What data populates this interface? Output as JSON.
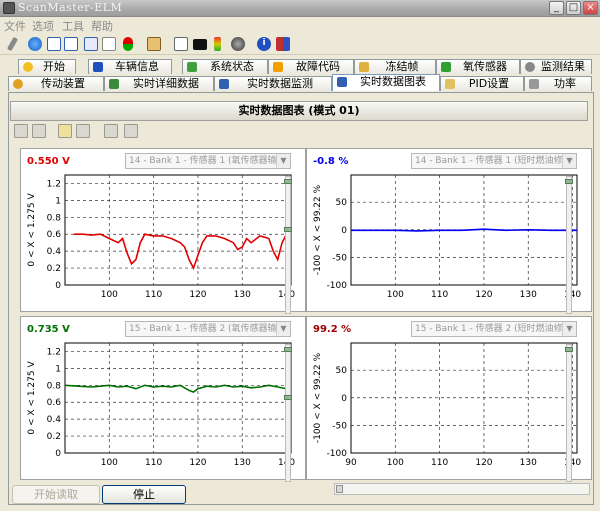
{
  "app": {
    "title": "ScanMaster-ELM"
  },
  "menu": [
    "文件",
    "选项",
    "工具",
    "帮助"
  ],
  "toolbar": [
    "wrench-icon",
    "globe-icon",
    "document-icon",
    "chart-icon",
    "meter-icon",
    "dice-icon",
    "clipboard-icon",
    "speech-icon",
    "monitor-icon",
    "battery-icon",
    "disc-icon",
    "info-icon",
    "book-icon"
  ],
  "tabs_row1": [
    "开始",
    "车辆信息",
    "系统状态",
    "故障代码",
    "冻结帧",
    "氧传感器",
    "监测结果"
  ],
  "tabs_row2": [
    "传动装置",
    "实时详细数据",
    "实时数据监测",
    "实时数据图表",
    "PID设置",
    "功率"
  ],
  "panel": {
    "title": "实时数据图表 (模式 01)"
  },
  "charts": [
    {
      "value": "0.550 V",
      "value_color": "#e00000",
      "select": "14 - Bank 1 - 传感器 1 (氧传感器输出",
      "ylabel": "0  < X <  1.275  V",
      "yticks": [
        "1.2",
        "1",
        "0.8",
        "0.6",
        "0.4",
        "0.2",
        "0"
      ],
      "xticks": [
        "100",
        "110",
        "120",
        "130",
        "140"
      ]
    },
    {
      "value": "-0.8 %",
      "value_color": "#0000ee",
      "select": "14 - Bank 1 - 传感器 1 (短时燃油修正",
      "ylabel": "-100  < X <  99.22  %",
      "yticks": [
        "50",
        "0",
        "-50",
        "-100"
      ],
      "xticks": [
        "100",
        "110",
        "120",
        "130",
        "140"
      ]
    },
    {
      "value": "0.735 V",
      "value_color": "#007000",
      "select": "15 - Bank 1 - 传感器 2 (氧传感器输出",
      "ylabel": "0  < X <  1.275  V",
      "yticks": [
        "1.2",
        "1",
        "0.8",
        "0.6",
        "0.4",
        "0.2",
        "0"
      ],
      "xticks": [
        "100",
        "110",
        "120",
        "130",
        "140"
      ]
    },
    {
      "value": "99.2 %",
      "value_color": "#a00000",
      "select": "15 - Bank 1 - 传感器 2 (短时燃油修正",
      "ylabel": "-100  < X <  99.22  %",
      "yticks": [
        "50",
        "0",
        "-50",
        "-100"
      ],
      "xticks": [
        "90",
        "100",
        "110",
        "120",
        "130",
        "140"
      ]
    }
  ],
  "chart_data": [
    {
      "type": "line",
      "x": [
        92,
        94,
        96,
        98,
        100,
        102,
        103,
        104,
        105,
        106,
        107,
        108,
        110,
        112,
        114,
        116,
        117,
        118,
        119,
        120,
        121,
        122,
        124,
        126,
        128,
        129,
        130,
        131,
        132,
        134,
        136,
        137,
        138,
        139,
        140,
        141
      ],
      "series": [
        {
          "values": [
            0.6,
            0.6,
            0.59,
            0.6,
            0.55,
            0.5,
            0.55,
            0.38,
            0.25,
            0.3,
            0.5,
            0.6,
            0.58,
            0.58,
            0.55,
            0.5,
            0.45,
            0.3,
            0.2,
            0.35,
            0.5,
            0.58,
            0.58,
            0.55,
            0.5,
            0.42,
            0.45,
            0.55,
            0.5,
            0.58,
            0.55,
            0.4,
            0.3,
            0.5,
            0.6,
            0.55
          ],
          "color": "#e00000"
        }
      ],
      "xlim": [
        90,
        141
      ],
      "ylim": [
        0,
        1.3
      ],
      "grid": true
    },
    {
      "type": "line",
      "x": [
        90,
        95,
        100,
        105,
        110,
        115,
        120,
        125,
        130,
        135,
        140,
        141
      ],
      "series": [
        {
          "values": [
            -1,
            -1,
            -1,
            -2,
            -1,
            -1,
            1,
            -1,
            0,
            -1,
            -1,
            -1
          ],
          "color": "#0000ee"
        }
      ],
      "xlim": [
        90,
        141
      ],
      "ylim": [
        -100,
        99.22
      ],
      "grid": true
    },
    {
      "type": "line",
      "x": [
        90,
        93,
        96,
        98,
        100,
        102,
        104,
        106,
        108,
        110,
        112,
        114,
        116,
        118,
        119,
        120,
        122,
        124,
        126,
        128,
        130,
        132,
        134,
        136,
        138,
        140,
        141
      ],
      "series": [
        {
          "values": [
            0.8,
            0.79,
            0.78,
            0.79,
            0.8,
            0.78,
            0.79,
            0.76,
            0.8,
            0.78,
            0.79,
            0.78,
            0.8,
            0.74,
            0.72,
            0.76,
            0.79,
            0.78,
            0.8,
            0.78,
            0.79,
            0.77,
            0.78,
            0.8,
            0.78,
            0.76,
            0.73
          ],
          "color": "#007000"
        }
      ],
      "xlim": [
        90,
        141
      ],
      "ylim": [
        0,
        1.3
      ],
      "grid": true
    },
    {
      "type": "line",
      "x": [],
      "series": [
        {
          "values": [],
          "color": "#a00000"
        }
      ],
      "xlim": [
        90,
        141
      ],
      "ylim": [
        -100,
        99.22
      ],
      "grid": true
    }
  ],
  "buttons": {
    "start": "开始读取",
    "stop": "停止"
  }
}
